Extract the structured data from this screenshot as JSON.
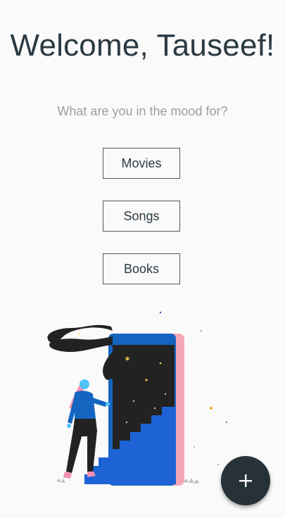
{
  "header": {
    "title": "Welcome, Tauseef!"
  },
  "prompt": {
    "text": "What are you in the mood for?"
  },
  "choices": [
    {
      "label": "Movies"
    },
    {
      "label": "Songs"
    },
    {
      "label": "Books"
    }
  ],
  "fab": {
    "icon": "plus-icon"
  },
  "colors": {
    "title": "#2b3a42",
    "subtitle": "#9e9e9e",
    "fab": "#263238",
    "phone": "#1565c0",
    "phone_edge": "#f4a7b4",
    "night": "#222222"
  }
}
